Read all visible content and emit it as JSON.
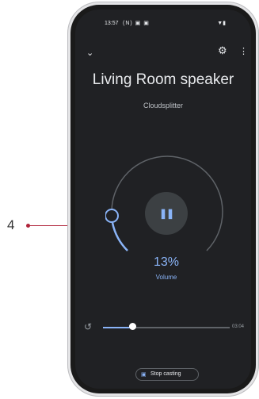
{
  "callout": {
    "number": "4"
  },
  "status_bar": {
    "time": "13:57",
    "left_icons": "(N) ▣ ▣",
    "right_icons": "▼▮"
  },
  "header": {
    "back_icon": "chevron-down-icon",
    "settings_icon": "gear-icon",
    "menu_icon": "more-vert-icon"
  },
  "device": {
    "name": "Living Room speaker",
    "app": "Cloudsplitter"
  },
  "volume": {
    "percent_label": "13%",
    "label": "Volume",
    "level": 0.13
  },
  "playback": {
    "state": "playing",
    "progress": 0.24,
    "duration": "03:04"
  },
  "stop_casting": {
    "label": "Stop casting"
  },
  "colors": {
    "accent": "#8ab4f8",
    "callout": "#b0243a",
    "background": "#202124"
  }
}
